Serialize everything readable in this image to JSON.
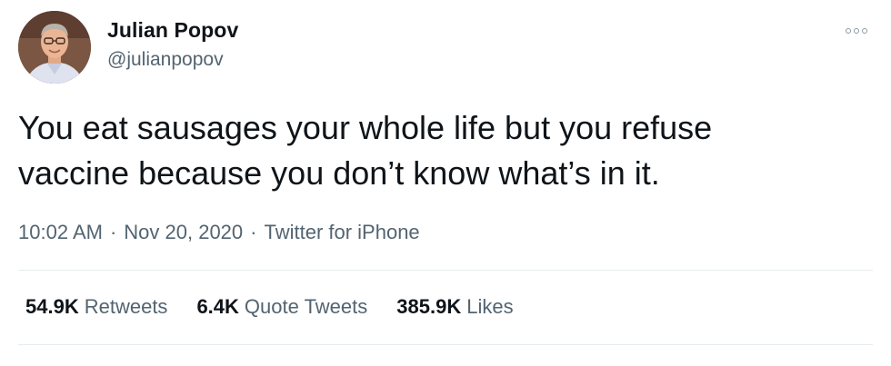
{
  "author": {
    "name": "Julian Popov",
    "handle": "@julianpopov",
    "avatar_icon": "profile-photo"
  },
  "tweet": {
    "text_lines": [
      "You eat sausages your whole life but you refuse",
      "vaccine because you don’t know what’s in it."
    ],
    "time": "10:02 AM",
    "date": "Nov 20, 2020",
    "source": "Twitter for iPhone",
    "separator": "·"
  },
  "stats": [
    {
      "count": "54.9K",
      "label": "Retweets"
    },
    {
      "count": "6.4K",
      "label": "Quote Tweets"
    },
    {
      "count": "385.9K",
      "label": "Likes"
    }
  ],
  "more_icon": "more-options-icon",
  "colors": {
    "text": "#0f1419",
    "secondary": "#536471",
    "divider": "#e6ecf0"
  }
}
